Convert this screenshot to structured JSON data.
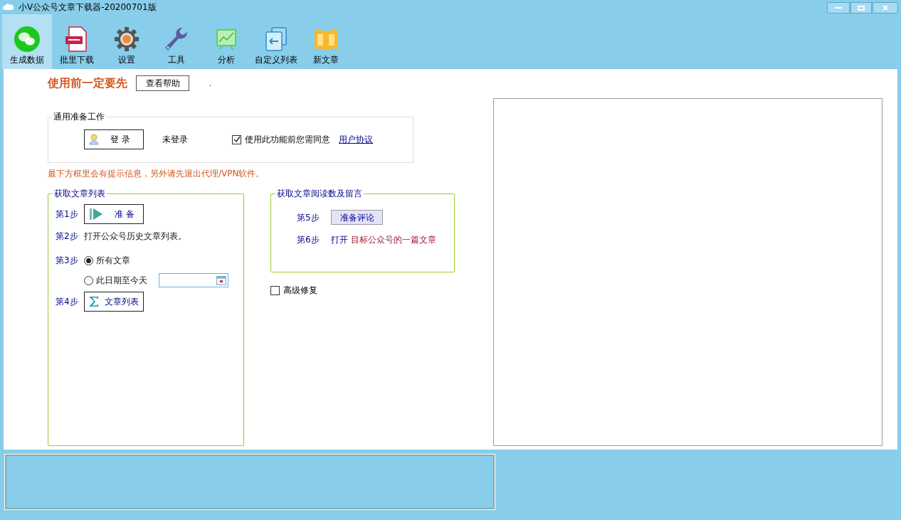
{
  "window": {
    "title": "小V公众号文章下载器-20200701版"
  },
  "toolbar": [
    {
      "label": "生成数据",
      "selected": true
    },
    {
      "label": "批里下载",
      "selected": false
    },
    {
      "label": "设置",
      "selected": false
    },
    {
      "label": "工具",
      "selected": false
    },
    {
      "label": "分析",
      "selected": false
    },
    {
      "label": "自定义列表",
      "selected": false
    },
    {
      "label": "新文章",
      "selected": false
    }
  ],
  "notice": {
    "heading": "使用前一定要先",
    "help_button": "查看帮助",
    "note": "."
  },
  "prep_group": {
    "title": "通用准备工作",
    "login_button": "登 录",
    "login_status": "未登录",
    "agreement": {
      "label": "使用此功能前您需同意",
      "checked": true
    },
    "agreement_link": "用户协议"
  },
  "hint": "最下方框里会有提示信息，另外请先退出代理/VPN软件。",
  "list_group": {
    "title": "获取文章列表",
    "steps": [
      {
        "step": "第1步",
        "kind": "button",
        "label": "准 备"
      },
      {
        "step": "第2步",
        "kind": "text",
        "text": "打开公众号历史文章列表。"
      },
      {
        "step": "第3步",
        "kind": "radios",
        "options": [
          {
            "label": "所有文章",
            "selected": true
          },
          {
            "label": "此日期至今天",
            "selected": false
          }
        ]
      },
      {
        "step": "第4步",
        "kind": "button",
        "label": "文章列表"
      }
    ]
  },
  "comment_group": {
    "title": "获取文章阅读数及留言",
    "steps": [
      {
        "step": "第5步",
        "kind": "button",
        "label": "准备评论"
      },
      {
        "step": "第6步",
        "kind": "link",
        "action": "打开",
        "target": "目标公众号的一篇文章"
      }
    ]
  },
  "advanced_repair": {
    "label": "高级修复",
    "checked": false
  }
}
